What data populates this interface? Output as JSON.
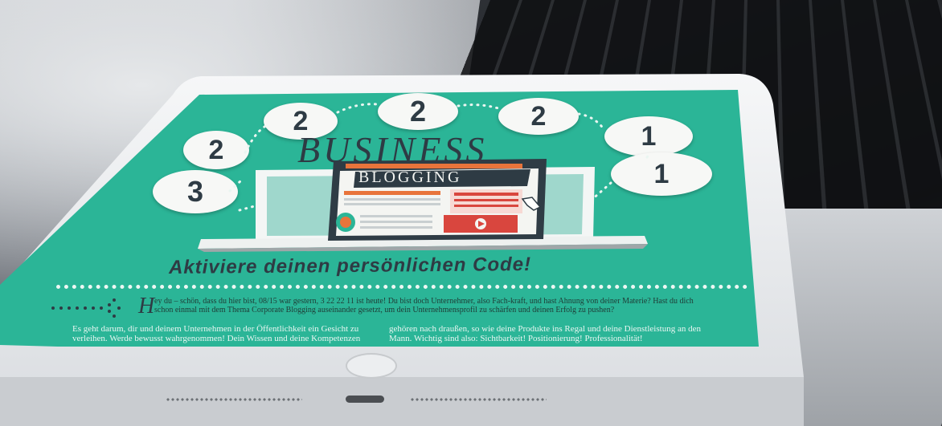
{
  "infographic": {
    "bubbles": [
      "2",
      "2",
      "2",
      "2",
      "1",
      "1",
      "3"
    ],
    "title_business": "BUSINESS",
    "title_blogging": "BLOGGING",
    "subtitle": "Aktiviere deinen persönlichen Code!",
    "drop_cap": "H",
    "intro_text": "ey du – schön, dass du hier bist, 08/15 war gestern, 3 22 22 11 ist heute! Du bist doch Unternehmer, also Fach-kraft, und hast Ahnung von deiner Materie? Hast du dich schon einmal mit dem Thema Corporate Blogging auseinander gesetzt, um dein Unternehmensprofil zu schärfen und deinen Erfolg zu pushen?",
    "col1_text": "Es geht darum, dir und deinem Unternehmen in der Öffentlichkeit ein Gesicht zu verleihen. Werde bewusst wahrgenommen! Dein Wissen und deine Kompetenzen",
    "col2_text": "gehören nach draußen, so wie deine Produkte ins Regal und deine Dienstleistung an den Mann. Wichtig sind also: Sichtbarkeit! Positionierung! Professionalität!"
  },
  "colors": {
    "screen_teal": "#2bb597",
    "dark_text": "#2e3b44",
    "accent_orange": "#e8743b",
    "accent_red": "#d9463e"
  }
}
